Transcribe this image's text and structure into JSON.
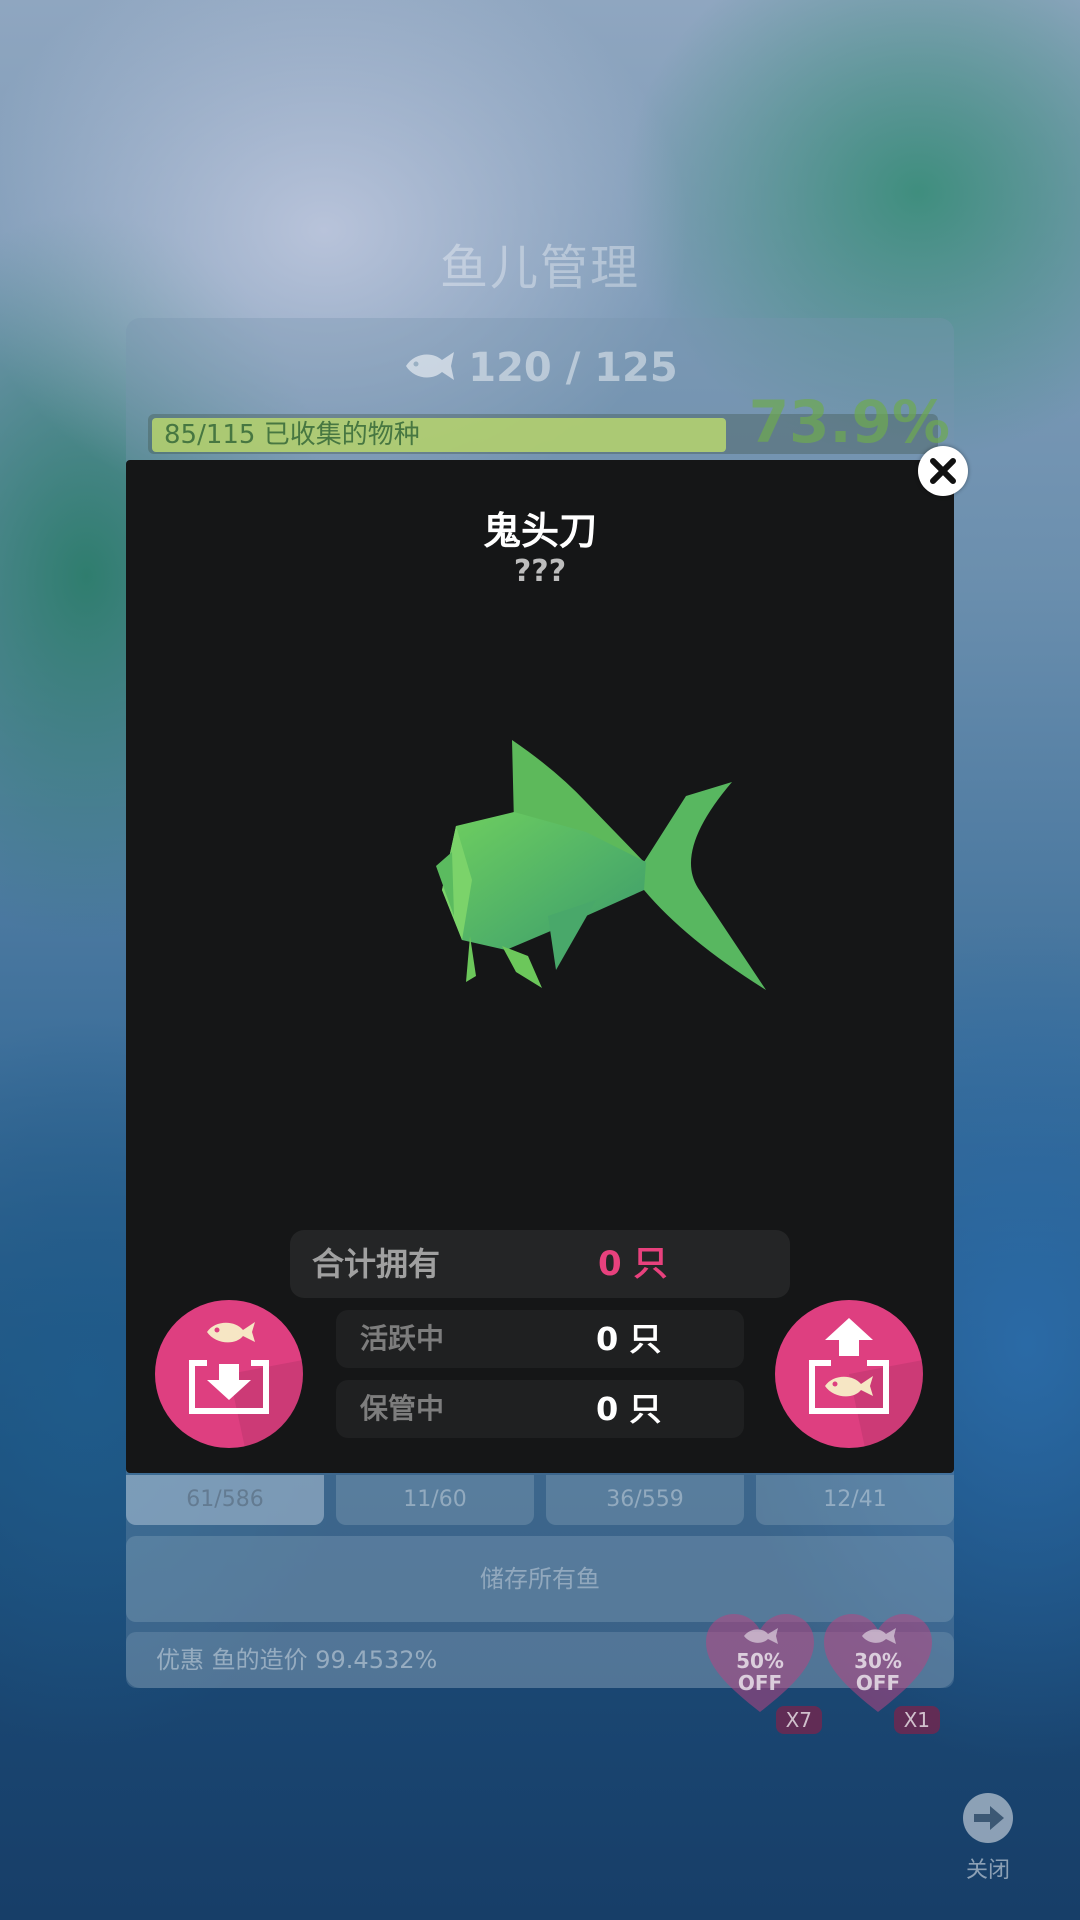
{
  "background": {
    "title": "鱼儿管理",
    "fish_count": "120 / 125",
    "collected": "85/115 已收集的物种",
    "percent": "73.9%",
    "tabs": [
      "61/586",
      "11/60",
      "36/559",
      "12/41"
    ],
    "store_all": "储存所有鱼",
    "discount": "优惠 鱼的造价 99.4532%",
    "coupons": [
      {
        "line1": "50%",
        "line2": "OFF",
        "count": "X7"
      },
      {
        "line1": "30%",
        "line2": "OFF",
        "count": "X1"
      }
    ],
    "close_label": "关闭"
  },
  "dialog": {
    "fish_name": "鬼头刀",
    "fish_subtitle": "???",
    "stats": {
      "total_label": "合计拥有",
      "total_value": "0 只",
      "active_label": "活跃中",
      "active_value": "0 只",
      "stored_label": "保管中",
      "stored_value": "0 只"
    }
  },
  "colors": {
    "accent_pink": "#de3f80",
    "total_value_pink": "#e8417d",
    "dialog_bg": "#151617",
    "fish_green": "#5bbf63"
  },
  "icons": {
    "dialog_close": "close-x-icon",
    "store_fish": "store-fish-icon",
    "release_fish": "release-fish-icon",
    "fish_count": "fish-icon",
    "page_close": "arrow-right-circle-icon"
  }
}
